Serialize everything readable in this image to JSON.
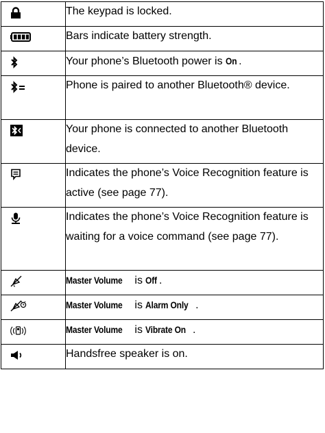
{
  "rows": [
    {
      "icon": "lock-icon",
      "text": "The keypad is locked."
    },
    {
      "icon": "battery-icon",
      "text": "Bars indicate battery strength."
    },
    {
      "icon": "bluetooth-icon",
      "text_before": "Your phone’s Bluetooth power is ",
      "emph": "On",
      "text_after": "."
    },
    {
      "icon": "bluetooth-paired-icon",
      "text": "Phone is paired to another Bluetooth® device."
    },
    {
      "icon": "bluetooth-connected-icon",
      "text": "Your phone is connected to another Bluetooth device."
    },
    {
      "icon": "voice-recognition-active-icon",
      "text": "Indicates the phone’s Voice Recognition feature is active (see page 77)."
    },
    {
      "icon": "voice-recognition-waiting-icon",
      "text": "Indicates the phone’s Voice Recognition feature is waiting for a voice command (see page 77)."
    },
    {
      "icon": "volume-off-icon",
      "emph1": "Master Volume",
      "mid": " is ",
      "emph2": "Off",
      "end": "."
    },
    {
      "icon": "alarm-only-icon",
      "emph1": "Master Volume",
      "mid": " is ",
      "emph2": "Alarm Only",
      "end": "."
    },
    {
      "icon": "vibrate-on-icon",
      "emph1": "Master Volume",
      "mid": " is ",
      "emph2": "Vibrate On",
      "end": "."
    },
    {
      "icon": "speaker-icon",
      "text": "Handsfree speaker is on."
    }
  ]
}
